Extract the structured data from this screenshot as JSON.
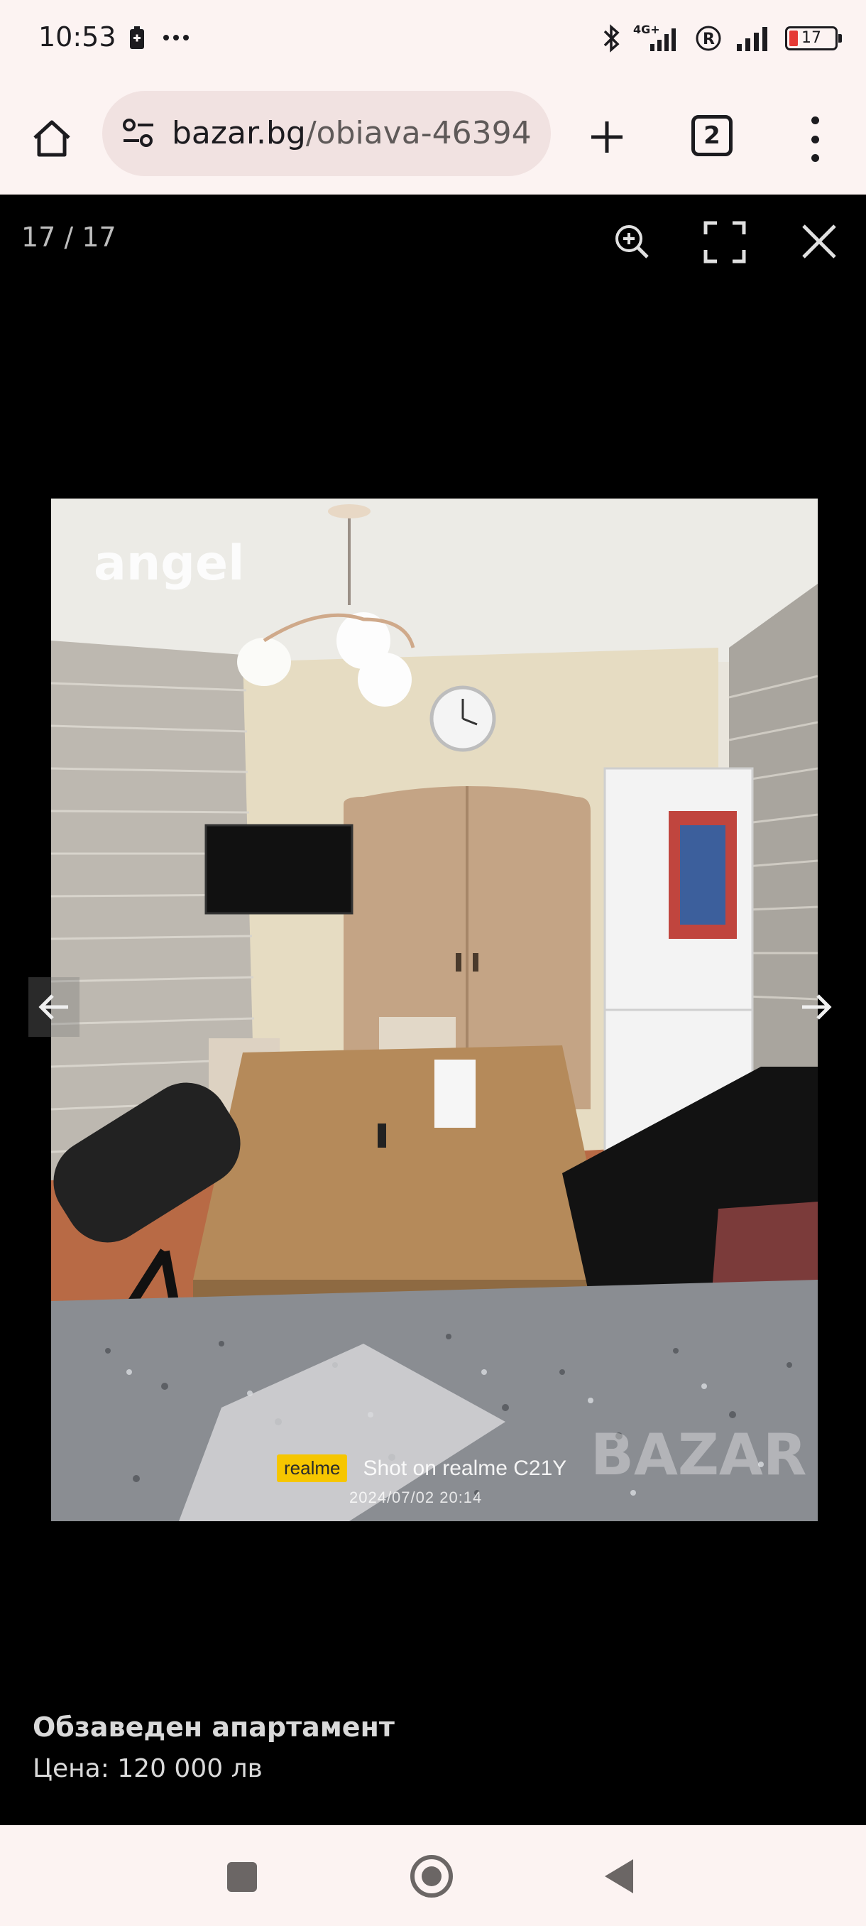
{
  "status_bar": {
    "time": "10:53",
    "network": "4G+",
    "battery": "17",
    "colors": {
      "battery_low": "#e53935"
    }
  },
  "browser": {
    "url_domain": "bazar.bg",
    "url_path": "/obiava-46394",
    "tab_count": "2",
    "icons": [
      "home-icon",
      "tune-icon",
      "add-icon",
      "tabs-icon",
      "more-vert-icon"
    ]
  },
  "viewer": {
    "counter": "17 / 17",
    "icons": [
      "zoom-in-icon",
      "fullscreen-icon",
      "close-icon",
      "arrow-left-icon",
      "arrow-right-icon"
    ]
  },
  "photo": {
    "watermark_angel": "angel",
    "realme_badge": "realme",
    "shot_text": "Shot on realme C21Y",
    "date_text": "2024/07/02 20:14",
    "bazar_watermark": "BAZAR"
  },
  "listing": {
    "title": "Обзаведен апартамент",
    "price": "Цена: 120 000 лв"
  },
  "navbar": {
    "icons": [
      "recent-apps-icon",
      "home-circle-icon",
      "back-icon"
    ]
  }
}
